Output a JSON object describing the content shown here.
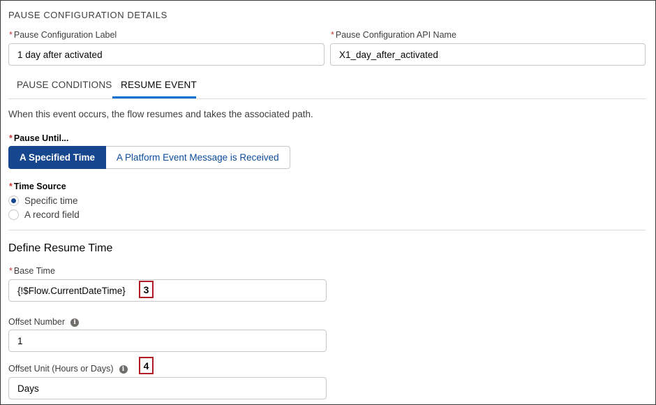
{
  "section": {
    "title": "PAUSE CONFIGURATION DETAILS"
  },
  "fields": {
    "label": {
      "label": "Pause Configuration Label",
      "value": "1 day after activated"
    },
    "api_name": {
      "label": "Pause Configuration API Name",
      "value": "X1_day_after_activated"
    }
  },
  "required_marker": "*",
  "tabs": [
    {
      "label": "PAUSE CONDITIONS",
      "active": false
    },
    {
      "label": "RESUME EVENT",
      "active": true
    }
  ],
  "description": "When this event occurs, the flow resumes and takes the associated path.",
  "pause_until": {
    "label": "Pause Until...",
    "options": [
      "A Specified Time",
      "A Platform Event Message is Received"
    ],
    "selected": "A Specified Time"
  },
  "time_source": {
    "label": "Time Source",
    "options": [
      "Specific time",
      "A record field"
    ],
    "selected": "Specific time"
  },
  "define_resume": {
    "heading": "Define Resume Time",
    "base_time": {
      "label": "Base Time",
      "value": "{!$Flow.CurrentDateTime}"
    },
    "offset_number": {
      "label": "Offset Number",
      "value": "1"
    },
    "offset_unit": {
      "label": "Offset Unit (Hours or Days)",
      "value": "Days"
    }
  },
  "info_icon_glyph": "i",
  "callouts": [
    "3",
    "4"
  ],
  "colors": {
    "brand": "#16468d",
    "required": "#c23934",
    "callout_border": "#b01c25",
    "tab_underline": "#0070d2"
  }
}
